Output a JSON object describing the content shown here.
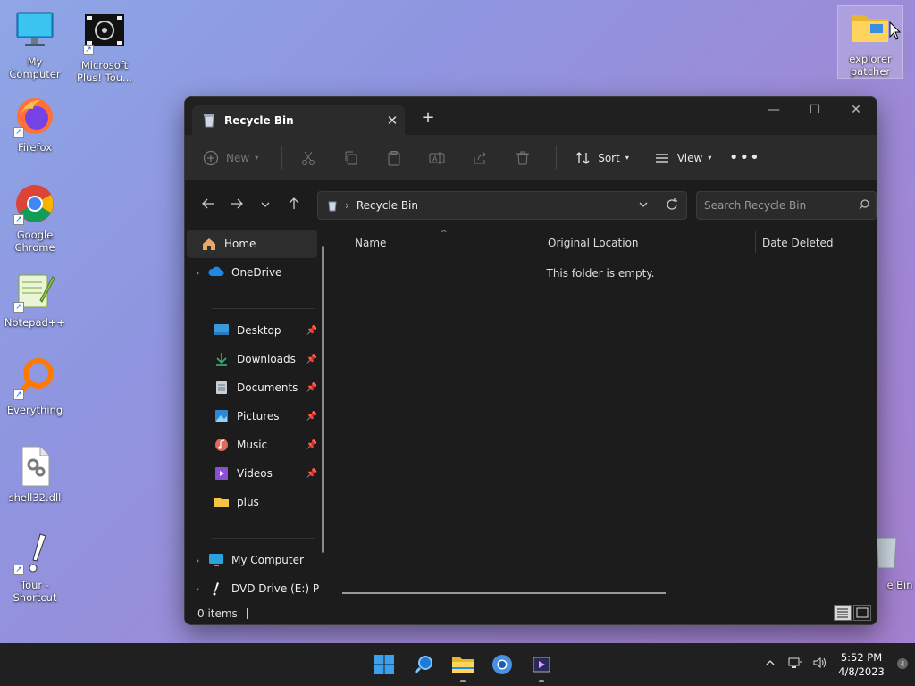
{
  "desktop": {
    "icons": [
      {
        "label": "My Computer",
        "icon": "monitor-icon"
      },
      {
        "label": "Microsoft Plus! Tou...",
        "icon": "plus-music-icon"
      },
      {
        "label": "Firefox",
        "icon": "firefox-icon"
      },
      {
        "label": "Google Chrome",
        "icon": "chrome-icon"
      },
      {
        "label": "Notepad++",
        "icon": "notepadpp-icon"
      },
      {
        "label": "Everything",
        "icon": "magnifier-icon"
      },
      {
        "label": "shell32.dll",
        "icon": "dll-file-icon"
      },
      {
        "label": "Tour - Shortcut",
        "icon": "tour-icon"
      },
      {
        "label": "explorer patcher",
        "icon": "folder-icon"
      },
      {
        "label": "e Bin",
        "icon": "recycle-bin-icon"
      }
    ]
  },
  "window": {
    "tab_title": "Recycle Bin",
    "toolbar": {
      "new_label": "New",
      "sort_label": "Sort",
      "view_label": "View"
    },
    "address": {
      "location": "Recycle Bin"
    },
    "search": {
      "placeholder": "Search Recycle Bin"
    },
    "nav": {
      "home": "Home",
      "onedrive": "OneDrive",
      "desktop": "Desktop",
      "downloads": "Downloads",
      "documents": "Documents",
      "pictures": "Pictures",
      "music": "Music",
      "videos": "Videos",
      "plus": "plus",
      "my_computer": "My Computer",
      "dvd_drive": "DVD Drive (E:) P"
    },
    "columns": {
      "name": "Name",
      "original_location": "Original Location",
      "date_deleted": "Date Deleted"
    },
    "empty_message": "This folder is empty.",
    "status": {
      "items": "0 items"
    }
  },
  "taskbar": {
    "time": "5:52 PM",
    "date": "4/8/2023"
  },
  "colors": {
    "accent": "#0078d4",
    "window_bg": "#1c1c1c",
    "toolbar_bg": "#2b2b2b"
  }
}
